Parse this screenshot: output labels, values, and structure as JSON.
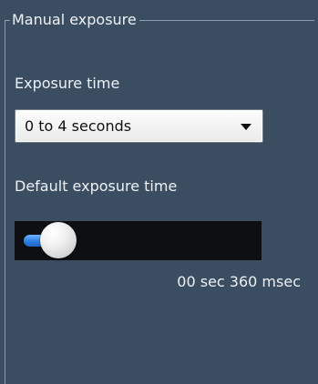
{
  "group": {
    "title": "Manual exposure"
  },
  "exposure_time": {
    "label": "Exposure time",
    "selected": "0 to 4 seconds"
  },
  "default_exposure": {
    "label": "Default exposure time",
    "slider_level_percent": 15,
    "readout": "00 sec 360 msec"
  },
  "colors": {
    "panel_background": "#3a4d61",
    "slider_fill": "#2d7fe0",
    "slider_track_background": "#0d0f12"
  },
  "icons": {
    "combo_arrow": "chevron-down-icon"
  }
}
